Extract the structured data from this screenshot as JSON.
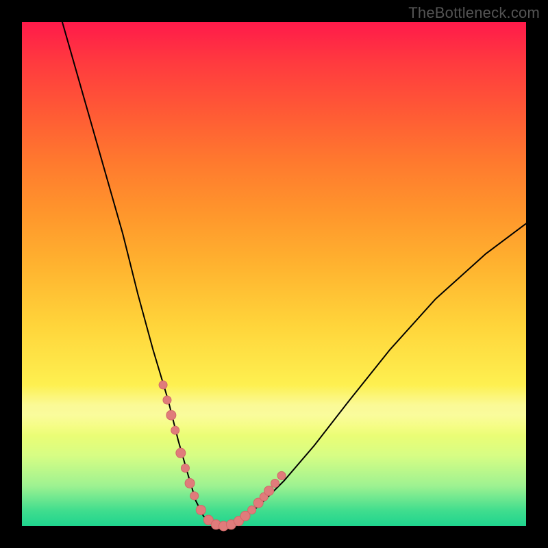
{
  "watermark_text": "TheBottleneck.com",
  "colors": {
    "page_bg": "#000000",
    "curve_stroke": "#000000",
    "marker_fill": "#e07b7b",
    "marker_stroke": "#d06868",
    "gradient_top": "#ff1a4a",
    "gradient_bottom": "#1fd48e"
  },
  "chart_data": {
    "type": "line",
    "title": "",
    "xlabel": "",
    "ylabel": "",
    "xlim": [
      0,
      100
    ],
    "ylim": [
      0,
      100
    ],
    "grid": false,
    "legend": false,
    "series": [
      {
        "name": "v-curve",
        "x": [
          8,
          12,
          16,
          20,
          23,
          26,
          29,
          31,
          33,
          34.5,
          36,
          38,
          40,
          43,
          47,
          52,
          58,
          65,
          73,
          82,
          92,
          100
        ],
        "y": [
          100,
          86,
          72,
          58,
          46,
          35,
          25,
          17,
          10,
          5,
          2,
          0,
          0,
          1,
          4,
          9,
          16,
          25,
          35,
          45,
          54,
          60
        ]
      }
    ],
    "markers": {
      "name": "salmon-dots",
      "x": [
        28.0,
        28.8,
        29.6,
        30.4,
        31.5,
        32.4,
        33.3,
        34.2,
        35.5,
        37.0,
        38.5,
        40.0,
        41.5,
        43.0,
        44.3,
        45.6,
        46.9,
        48.0,
        49.0,
        50.2,
        51.5
      ],
      "y": [
        28.0,
        25.0,
        22.0,
        19.0,
        14.5,
        11.5,
        8.5,
        6.0,
        3.2,
        1.2,
        0.3,
        0.0,
        0.3,
        1.0,
        2.0,
        3.2,
        4.6,
        5.8,
        7.0,
        8.5,
        10.0
      ],
      "r": [
        6,
        6,
        7,
        6,
        7,
        6,
        7,
        6,
        7,
        7,
        7,
        7,
        7,
        7,
        7,
        6,
        7,
        6,
        7,
        6,
        6
      ]
    }
  }
}
